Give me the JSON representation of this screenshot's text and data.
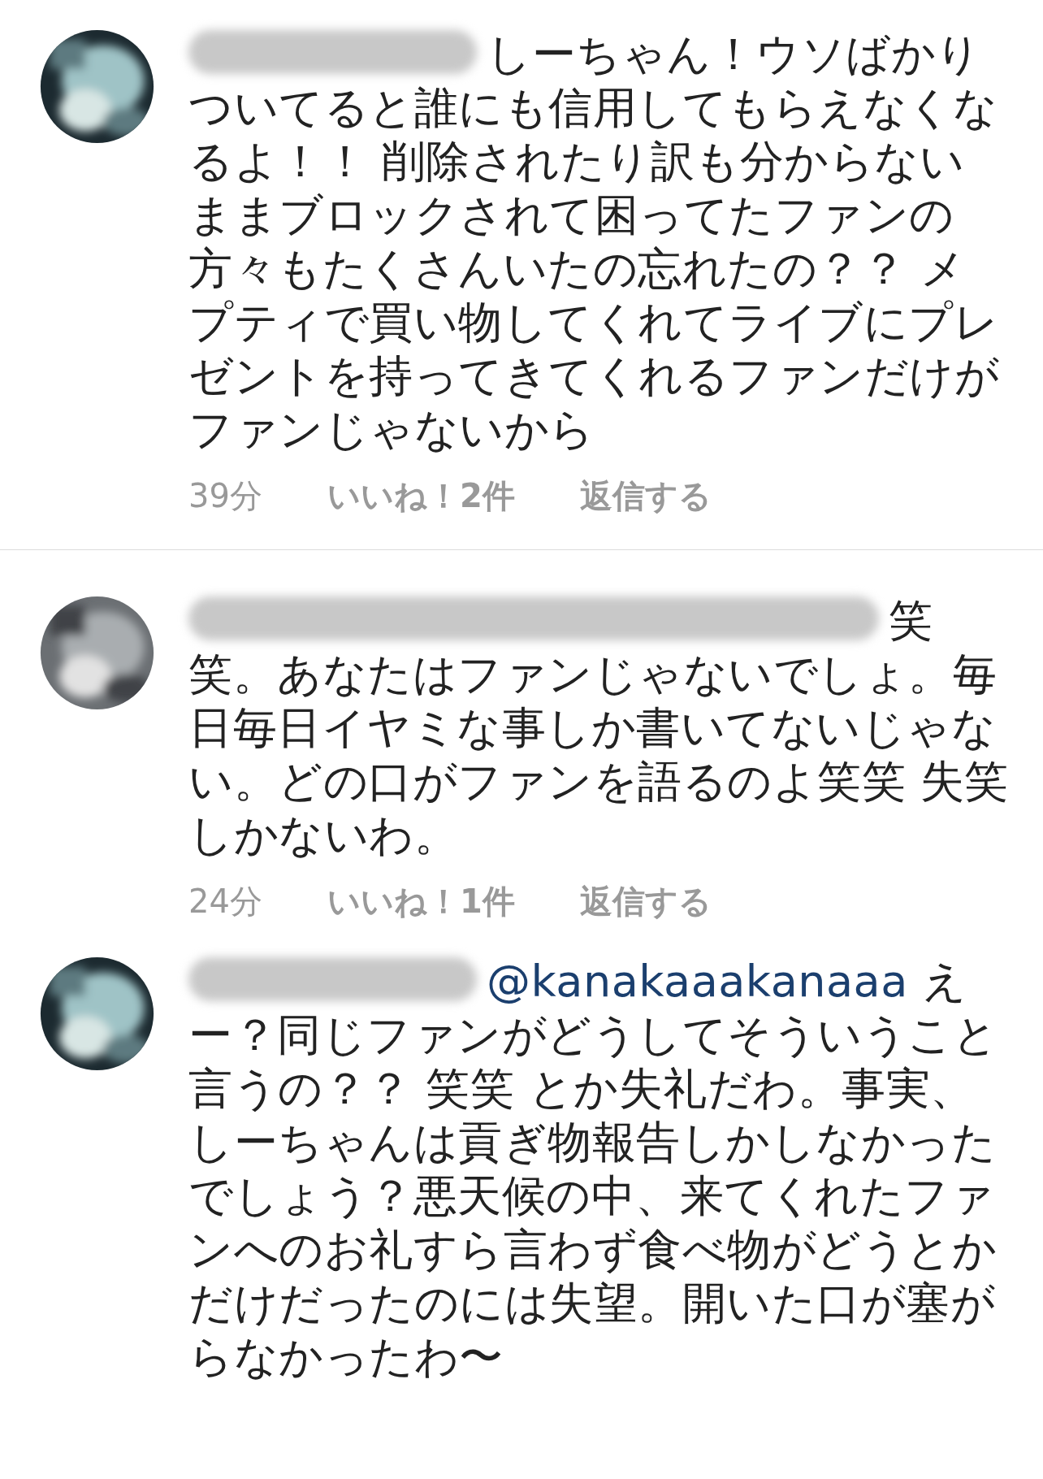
{
  "comments": [
    {
      "text": "しーちゃん！ウソばかりついてると誰にも信用してもらえなくなるよ！！ 削除されたり訳も分からないままブロックされて困ってたファンの方々もたくさんいたの忘れたの？？ メプティで買い物してくれてライブにプレゼントを持ってきてくれるファンだけがファンじゃないから",
      "time": "39分",
      "likes": "いいね！2件",
      "reply": "返信する",
      "divider_after": true
    },
    {
      "text": "笑笑。あなたはファンじゃないでしょ。毎日毎日イヤミな事しか書いてないじゃない。どの口がファンを語るのよ笑笑 失笑しかないわ。",
      "time": "24分",
      "likes": "いいね！1件",
      "reply": "返信する",
      "divider_after": false
    },
    {
      "mention": "@kanakaaakanaaa",
      "text": "えー？同じファンがどうしてそういうこと言うの？？ 笑笑 とか失礼だわ。事実、しーちゃんは貢ぎ物報告しかしなかったでしょう？悪天候の中、来てくれたファンへのお礼すら言わず食べ物がどうとかだけだったのには失望。開いた口が塞がらなかったわ〜",
      "divider_after": false
    }
  ]
}
